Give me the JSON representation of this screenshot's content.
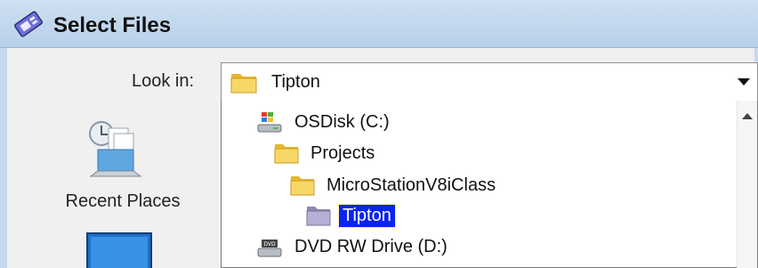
{
  "window": {
    "title": "Select Files",
    "icon": "select-files-icon"
  },
  "look_in": {
    "label": "Look in:",
    "value": "Tipton",
    "value_icon": "folder-icon",
    "options": [
      {
        "label": "OSDisk (C:)",
        "icon": "drive-windows-icon",
        "indent": 0
      },
      {
        "label": "Projects",
        "icon": "folder-icon",
        "indent": 1
      },
      {
        "label": "MicroStationV8iClass",
        "icon": "folder-icon",
        "indent": 2
      },
      {
        "label": "Tipton",
        "icon": "folder-open-icon",
        "indent": 3,
        "selected": true
      },
      {
        "label": "DVD RW Drive (D:)",
        "icon": "dvd-drive-icon",
        "indent": 0
      }
    ]
  },
  "places": [
    {
      "label": "Recent Places",
      "icon": "recent-places-icon"
    },
    {
      "label": "",
      "icon": "desktop-icon"
    }
  ],
  "colors": {
    "selection": "#0a24f0",
    "titlebar": "#b7d0ea"
  }
}
